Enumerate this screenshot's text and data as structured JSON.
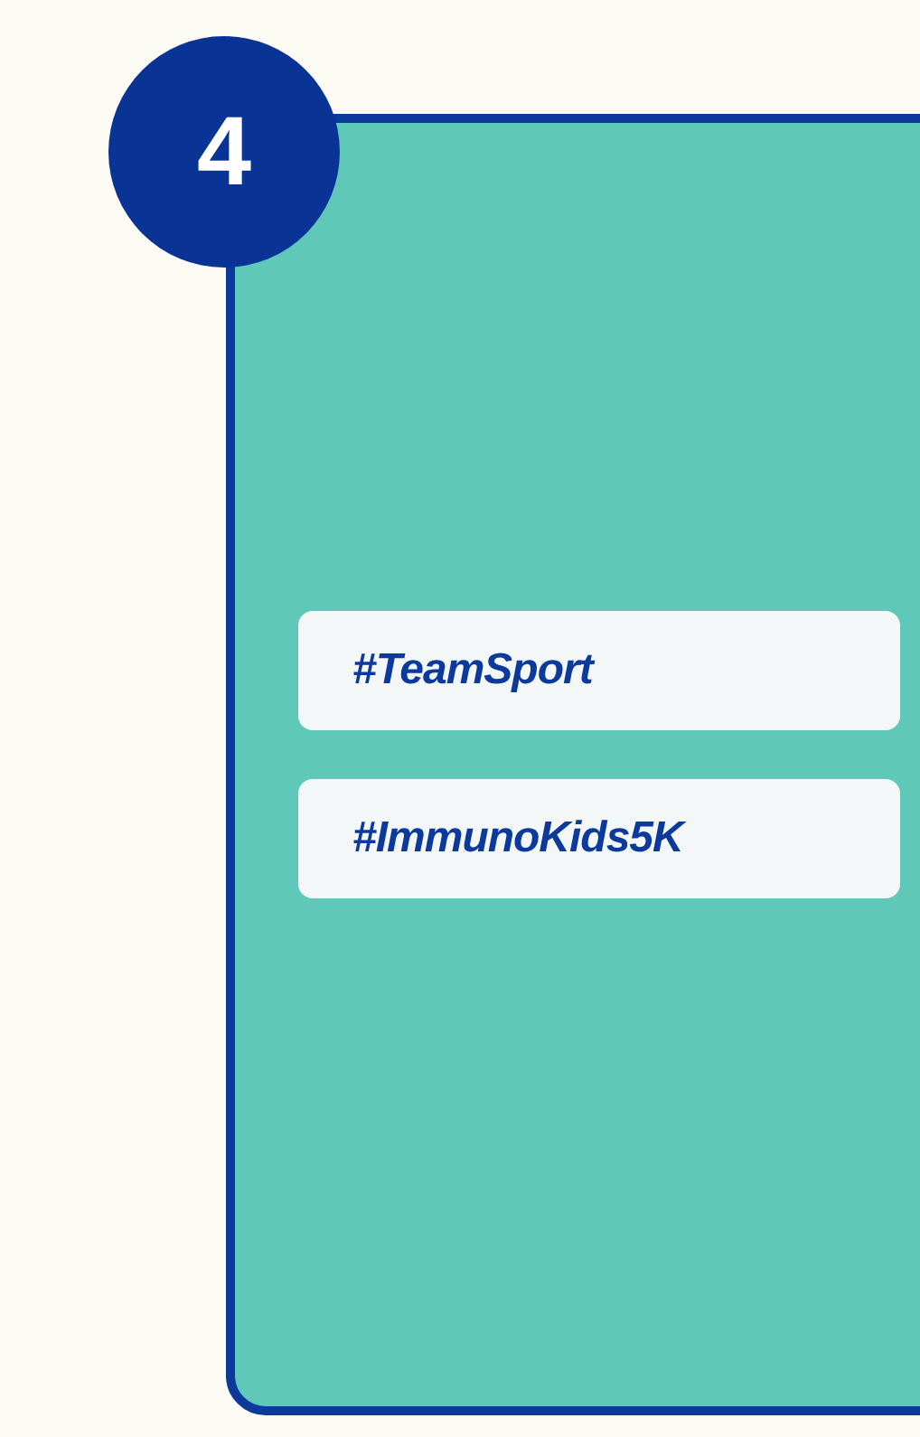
{
  "step": {
    "number": "4"
  },
  "tags": [
    {
      "text": "#TeamSport"
    },
    {
      "text": "#ImmunoKids5K"
    }
  ]
}
